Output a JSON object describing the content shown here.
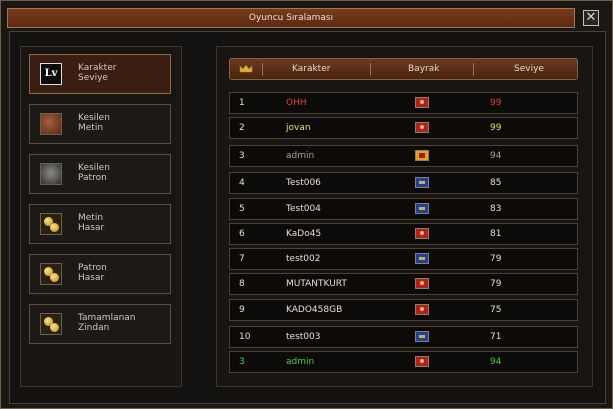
{
  "window": {
    "title": "Oyuncu Sıralaması",
    "close_glyph": "✕"
  },
  "categories": [
    {
      "label": "Karakter\nSeviye",
      "icon": "lv-icon",
      "icon_text": "Lv",
      "active": true
    },
    {
      "label": "Kesilen\nMetin",
      "icon": "metin-stone-icon",
      "active": false
    },
    {
      "label": "Kesilen\nPatron",
      "icon": "boss-icon",
      "active": false
    },
    {
      "label": "Metin\nHasar",
      "icon": "gold-coins-icon",
      "active": false
    },
    {
      "label": "Patron\nHasar",
      "icon": "gold-coins-icon",
      "active": false
    },
    {
      "label": "Tamamlanan\nZindan",
      "icon": "gold-coins-icon",
      "active": false
    }
  ],
  "table": {
    "headers": {
      "character": "Karakter",
      "flag": "Bayrak",
      "level": "Seviye"
    },
    "rows": [
      {
        "rank": "1",
        "name": "OHH",
        "flag": "red",
        "level": "99",
        "name_color": "#e04040",
        "level_color": "#e04040"
      },
      {
        "rank": "2",
        "name": "jovan",
        "flag": "red",
        "level": "99",
        "name_color": "#e8e060",
        "level_color": "#e8e060"
      },
      {
        "rank": "3",
        "name": "admin",
        "flag": "yellow",
        "level": "94",
        "name_color": "#a8a098",
        "level_color": "#a8a098"
      },
      {
        "rank": "4",
        "name": "Test006",
        "flag": "blue",
        "level": "85",
        "name_color": "#e8e0d0",
        "level_color": "#e8e0d0"
      },
      {
        "rank": "5",
        "name": "Test004",
        "flag": "blue",
        "level": "83",
        "name_color": "#e8e0d0",
        "level_color": "#e8e0d0"
      },
      {
        "rank": "6",
        "name": "KaDo45",
        "flag": "red",
        "level": "81",
        "name_color": "#e8e0d0",
        "level_color": "#e8e0d0"
      },
      {
        "rank": "7",
        "name": "test002",
        "flag": "blue",
        "level": "79",
        "name_color": "#e8e0d0",
        "level_color": "#e8e0d0"
      },
      {
        "rank": "8",
        "name": "MUTANTKURT",
        "flag": "red",
        "level": "79",
        "name_color": "#e8e0d0",
        "level_color": "#e8e0d0"
      },
      {
        "rank": "9",
        "name": "KADO458GB",
        "flag": "red",
        "level": "75",
        "name_color": "#e8e0d0",
        "level_color": "#e8e0d0"
      },
      {
        "rank": "10",
        "name": "test003",
        "flag": "blue",
        "level": "71",
        "name_color": "#e8e0d0",
        "level_color": "#e8e0d0"
      }
    ],
    "self_row": {
      "rank": "3",
      "name": "admin",
      "flag": "red",
      "level": "94",
      "name_color": "#40d040",
      "level_color": "#40d040"
    }
  }
}
